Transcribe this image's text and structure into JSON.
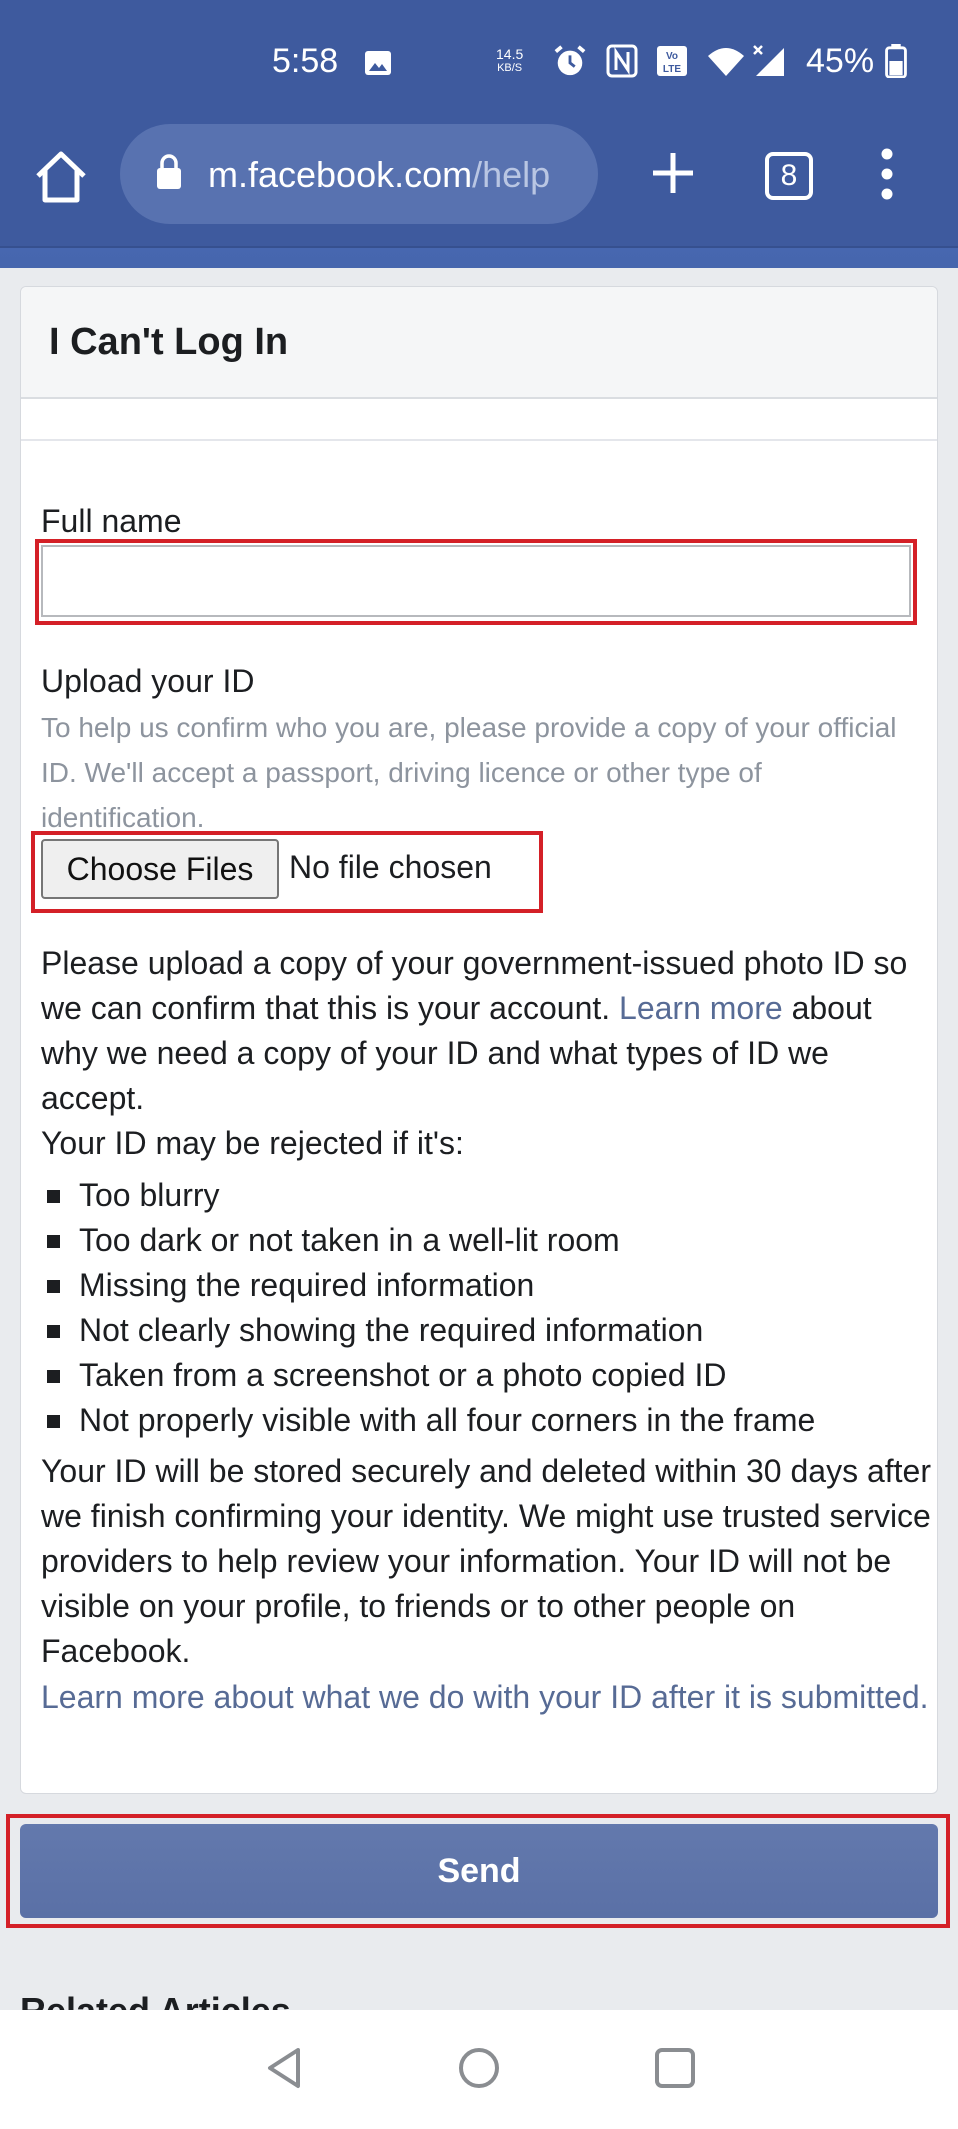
{
  "status_bar": {
    "time": "5:58",
    "net_speed_value": "14.5",
    "net_speed_unit": "KB/S",
    "battery_percent": "45%"
  },
  "browser": {
    "url_main": "m.facebook.com",
    "url_rest": "/help",
    "tab_count": "8"
  },
  "page": {
    "title": "I Can't Log In",
    "full_name_label": "Full name",
    "full_name_value": "",
    "upload_label": "Upload your ID",
    "upload_help": "To help us confirm who you are, please provide a copy of your official ID. We'll accept a passport, driving licence or other type of identification.",
    "choose_files_label": "Choose Files",
    "no_file_text": "No file chosen",
    "para1_before": "Please upload a copy of your government-issued photo ID so we can confirm that this is your account. ",
    "para1_link": "Learn more",
    "para1_after": " about why we need a copy of your ID and what types of ID we accept.",
    "reject_intro": "Your ID may be rejected if it's:",
    "reject_reasons": [
      "Too blurry",
      "Too dark or not taken in a well-lit room",
      "Missing the required information",
      "Not clearly showing the required information",
      "Taken from a screenshot or a photo copied ID",
      "Not properly visible with all four corners in the frame"
    ],
    "storage_text": "Your ID will be stored securely and deleted within 30 days after we finish confirming your identity. We might use trusted service providers to help review your information. Your ID will not be visible on your profile, to friends or to other people on Facebook.",
    "storage_link": "Learn more about what we do with your ID after it is submitted.",
    "send_label": "Send",
    "related_heading": "Related Articles"
  },
  "colors": {
    "chrome": "#3e5a9e",
    "highlight": "#d42027",
    "link": "#576b95",
    "send": "#5a70a6"
  }
}
